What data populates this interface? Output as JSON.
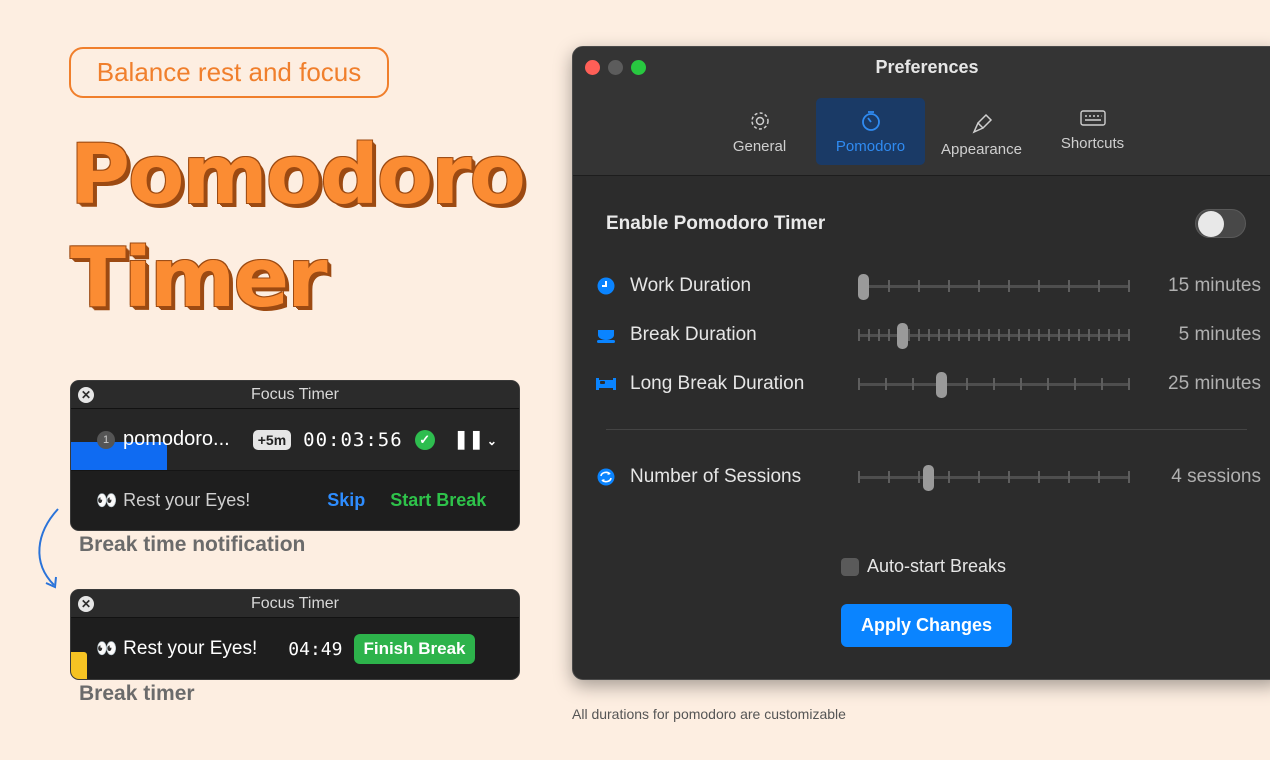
{
  "promo": {
    "pill": "Balance rest and focus",
    "headline_line1": "Pomodoro",
    "headline_line2": "Timer",
    "caption1": "Break time notification",
    "caption2": "Break timer",
    "footer": "All durations for pomodoro are customizable"
  },
  "mini_timer1": {
    "title": "Focus Timer",
    "session_number": "1",
    "session_name": "pomodoro...",
    "extend_label": "+5m",
    "elapsed": "00:03:56",
    "message": "Rest your Eyes!",
    "eyes_emoji": "👀",
    "skip_label": "Skip",
    "start_label": "Start Break",
    "progress_color": "#0f6bf2"
  },
  "mini_timer2": {
    "title": "Focus Timer",
    "message": "Rest your Eyes!",
    "eyes_emoji": "👀",
    "remaining": "04:49",
    "finish_label": "Finish Break",
    "progress_color": "#f6c323"
  },
  "preferences": {
    "window_title": "Preferences",
    "tabs": [
      {
        "label": "General",
        "icon": "gear-icon"
      },
      {
        "label": "Pomodoro",
        "icon": "timer-icon",
        "active": true
      },
      {
        "label": "Appearance",
        "icon": "paintbrush-icon"
      },
      {
        "label": "Shortcuts",
        "icon": "keyboard-icon"
      }
    ],
    "enable_label": "Enable Pomodoro Timer",
    "enable_on": false,
    "sliders": [
      {
        "label": "Work Duration",
        "value": "15 minutes",
        "icon": "clock-icon",
        "fraction": 0.0
      },
      {
        "label": "Break Duration",
        "value": "5 minutes",
        "icon": "coffee-icon",
        "fraction": 0.15
      },
      {
        "label": "Long Break Duration",
        "value": "25 minutes",
        "icon": "bed-icon",
        "fraction": 0.3
      },
      {
        "label": "Number of Sessions",
        "value": "4 sessions",
        "icon": "repeat-icon",
        "fraction": 0.25
      }
    ],
    "auto_start_label": "Auto-start Breaks",
    "auto_start_checked": false,
    "apply_label": "Apply Changes"
  }
}
